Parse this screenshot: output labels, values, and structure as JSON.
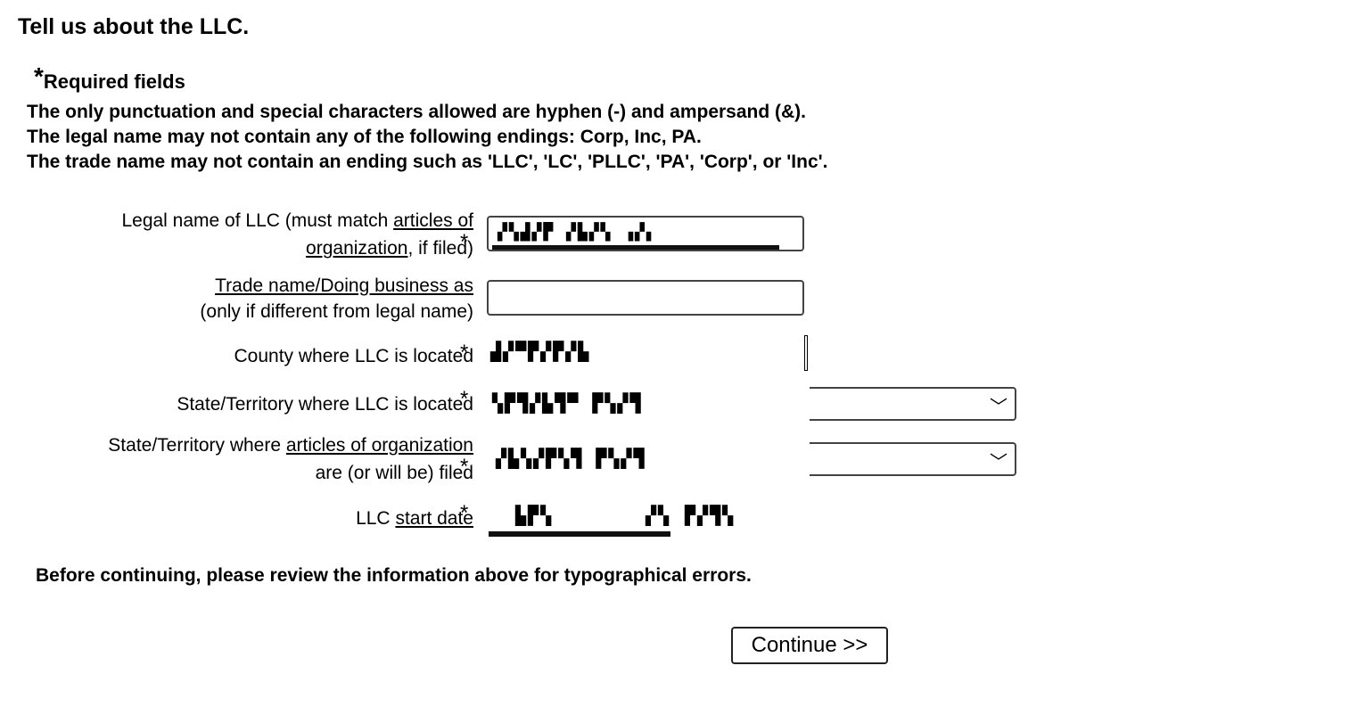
{
  "page": {
    "title": "Tell us about the LLC.",
    "required_star": "*",
    "required_label": "Required fields",
    "rules": [
      "The only punctuation and special characters allowed are hyphen (-) and ampersand (&).",
      "The legal name may not contain any of the following endings: Corp, Inc, PA.",
      "The trade name may not contain an ending such as 'LLC', 'LC', 'PLLC', 'PA', 'Corp', or 'Inc'."
    ]
  },
  "form": {
    "legal_name": {
      "label_prefix": "Legal name of LLC (must match ",
      "label_link1": "articles of",
      "label_link2": "organization",
      "label_suffix": ", if filed)",
      "star": "*",
      "value": "▞▚▟▞▛ ▞▙▞▚ ▗▞▖"
    },
    "trade_name": {
      "label_link": "Trade name/Doing business as",
      "label_line2": "(only if different from legal name)",
      "value": ""
    },
    "county": {
      "label": "County where LLC is located",
      "star": "*",
      "value": "▟▞▀▛▞▛▞▙"
    },
    "state_located": {
      "label": "State/Territory where LLC is located",
      "star": "*",
      "value": "▚▛▜▞▙▜▀ ▛▚▞▜",
      "chevron": "﹀"
    },
    "state_filed": {
      "label_prefix": "State/Territory where ",
      "label_link": "articles of organization",
      "label_line2": "are (or will be) filed",
      "star": "*",
      "value": "▞▙▚▞▛▚▜ ▛▚▞▜",
      "chevron": "﹀"
    },
    "start_date": {
      "label_prefix": "LLC ",
      "label_link": "start date",
      "star": "*",
      "value1": "▙▛▚",
      "value2": "▞▚",
      "value3": "▛▞▜▚"
    }
  },
  "footer": {
    "note": "Before continuing, please review the information above for typographical errors.",
    "continue_label": "Continue >>"
  }
}
